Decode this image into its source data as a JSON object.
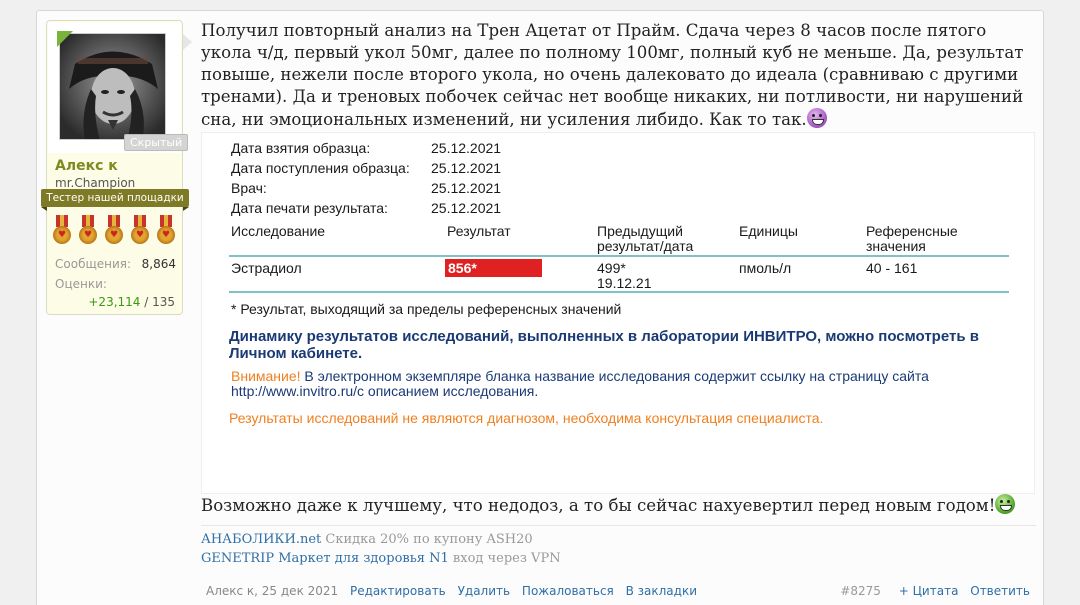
{
  "user": {
    "name": "Алекс к",
    "title": "mr.Champion",
    "banner": "Тестер нашей площадки",
    "hidden_badge": "Скрытый",
    "stats": {
      "messages_label": "Сообщения:",
      "messages_value": "8,864",
      "ratings_label": "Оценки:",
      "ratings_positive": "+23,114",
      "ratings_separator": " / ",
      "ratings_total": "135"
    },
    "medal_count": 5
  },
  "post": {
    "text1": "Получил повторный анализ на Трен Ацетат от Прайм. Сдача через 8 часов после пятого укола ч/д, первый укол 50мг, далее по полному 100мг, полный куб не меньше. Да, результат повыше, нежели после второго укола, но очень далековато до идеала (сравниваю с другими тренами). Да и треновых побочек сейчас нет вообще никаких, ни потливости, ни нарушений сна, ни эмоциональных изменений, ни усиления либидо. Как то так.",
    "text2": "Возможно даже к лучшему, что недодоз, а то бы сейчас нахуевертил перед новым годом!"
  },
  "lab": {
    "meta": [
      {
        "k": "Дата взятия образца:",
        "v": "25.12.2021"
      },
      {
        "k": "Дата поступления образца:",
        "v": "25.12.2021"
      },
      {
        "k": "Врач:",
        "v": "25.12.2021"
      },
      {
        "k": "Дата печати результата:",
        "v": "25.12.2021"
      }
    ],
    "headers": {
      "study": "Исследование",
      "result": "Результат",
      "prev1": "Предыдущий",
      "prev2": "результат/дата",
      "units": "Единицы",
      "ref1": "Референсные",
      "ref2": "значения"
    },
    "row": {
      "study": "Эстрадиол",
      "result": "856*",
      "prev_value": "499*",
      "prev_date": "19.12.21",
      "units": "пмоль/л",
      "ref": "40 - 161"
    },
    "footnote": "* Результат, выходящий за пределы референсных значений",
    "dynamics": "Динамику результатов исследований, выполненных в лаборатории ИНВИТРО, можно посмотреть в Личном кабинете.",
    "warning_label": "Внимание!",
    "warning_text": " В электронном экземпляре бланка название исследования содержит ссылку на страницу сайта http://www.invitro.ru/с описанием исследования.",
    "disclaimer": "Результаты исследований не являются диагнозом, необходима консультация специалиста."
  },
  "signature": [
    {
      "link": "АНАБОЛИКИ.net",
      "text": " Скидка 20% по купону ASH20"
    },
    {
      "link": "GENETRIP Маркет для здоровья N1",
      "text": " вход через VPN"
    }
  ],
  "meta": {
    "author_date": "Алекс к, 25 дек 2021",
    "edit": "Редактировать",
    "delete": "Удалить",
    "report": "Пожаловаться",
    "bookmark": "В закладки",
    "post_number": "#8275",
    "quote": "+ Цитата",
    "reply": "Ответить"
  }
}
